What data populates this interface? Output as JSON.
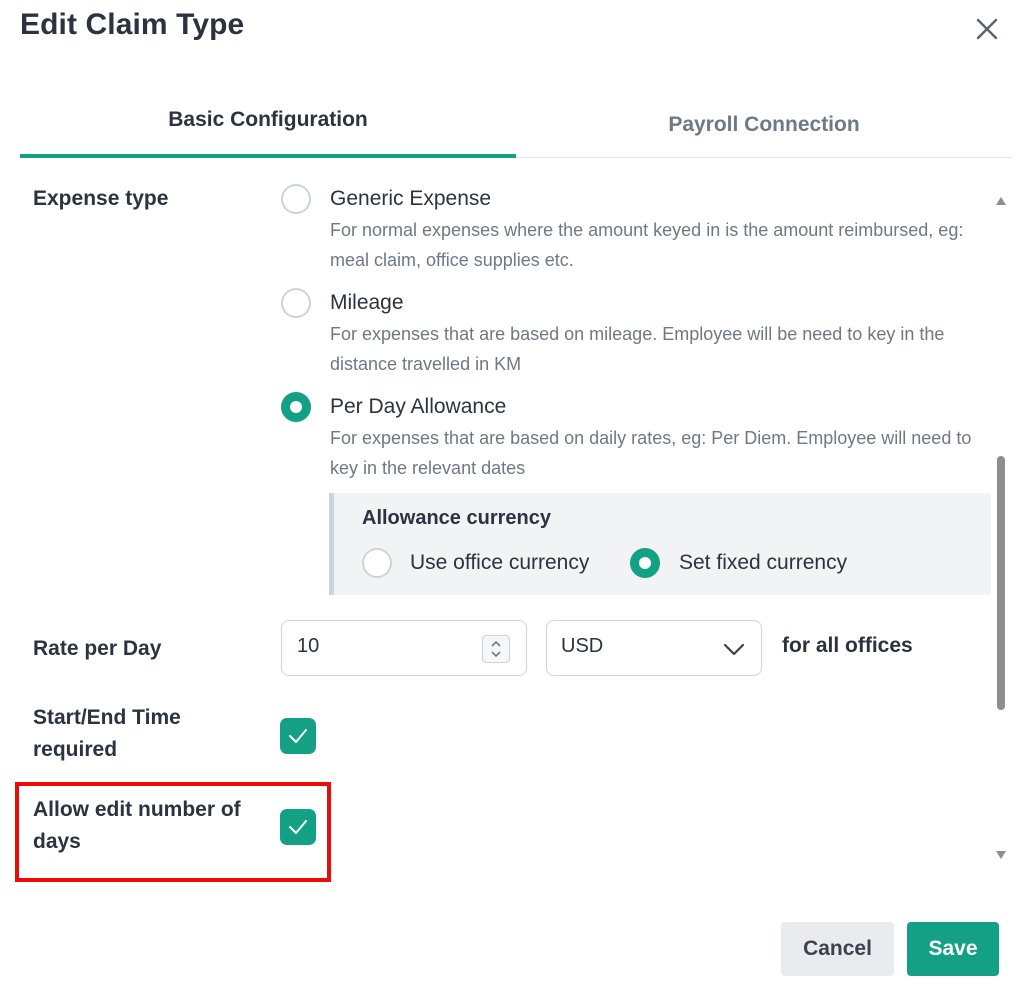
{
  "dialog": {
    "title": "Edit Claim Type",
    "close_icon": "close-icon"
  },
  "tabs": [
    {
      "label": "Basic Configuration",
      "active": true
    },
    {
      "label": "Payroll Connection",
      "active": false
    }
  ],
  "expense_type": {
    "label": "Expense type",
    "options": [
      {
        "title": "Generic Expense",
        "description": "For normal expenses where the amount keyed in is the amount reimbursed, eg: meal claim, office supplies etc.",
        "selected": false
      },
      {
        "title": "Mileage",
        "description": "For expenses that are based on mileage. Employee will be need to key in the distance travelled in KM",
        "selected": false
      },
      {
        "title": "Per Day Allowance",
        "description": "For expenses that are based on daily rates, eg: Per Diem. Employee will need to key in the relevant dates",
        "selected": true
      }
    ]
  },
  "allowance_currency": {
    "title": "Allowance currency",
    "options": [
      {
        "label": "Use office currency",
        "selected": false
      },
      {
        "label": "Set fixed currency",
        "selected": true
      }
    ]
  },
  "rate_per_day": {
    "label": "Rate per Day",
    "value": "10",
    "currency": "USD",
    "suffix": "for all offices"
  },
  "start_end_time": {
    "label": "Start/End Time required",
    "checked": true
  },
  "allow_edit_days": {
    "label": "Allow edit number of days",
    "checked": true
  },
  "footer": {
    "cancel_label": "Cancel",
    "save_label": "Save"
  },
  "colors": {
    "accent": "#14a085",
    "highlight": "#ea0b0b",
    "text": "#2b3340",
    "muted": "#6f7885"
  }
}
